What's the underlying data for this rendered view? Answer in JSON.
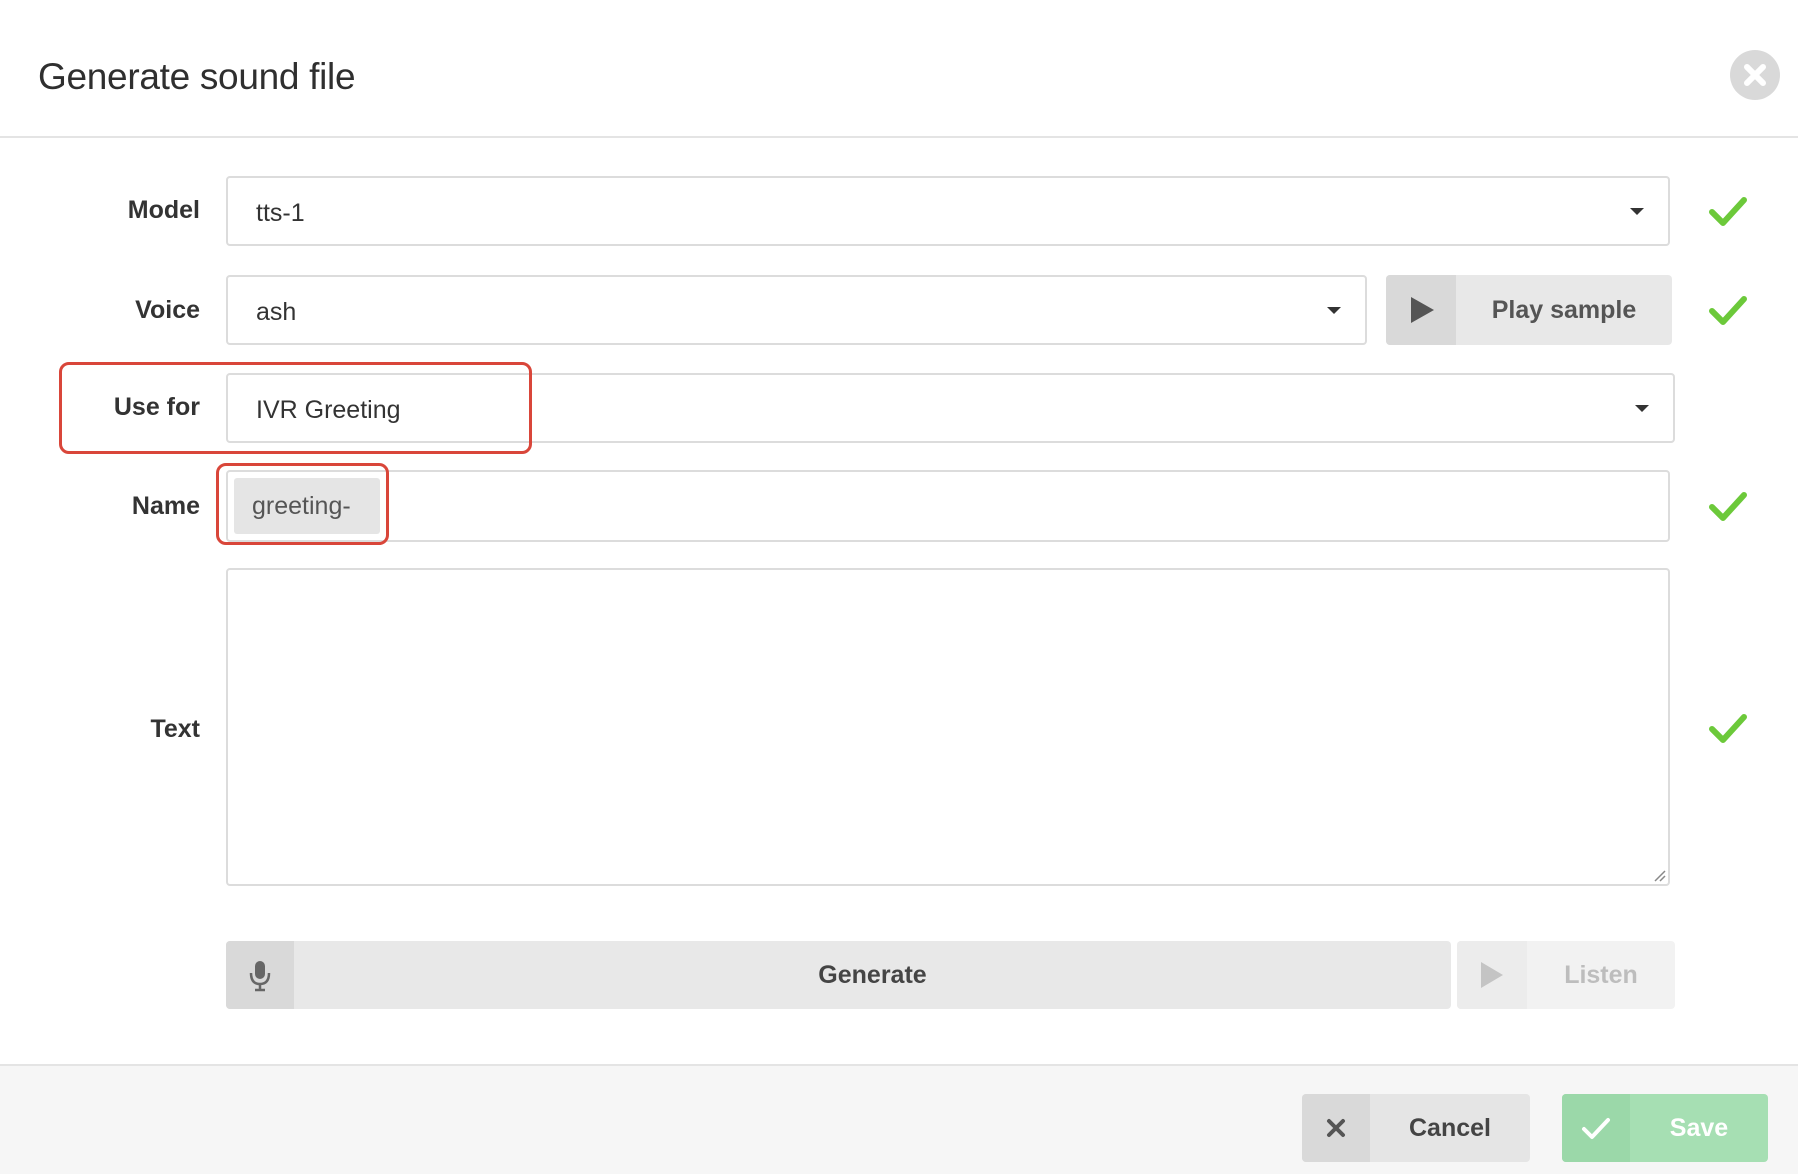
{
  "dialog": {
    "title": "Generate sound file"
  },
  "form": {
    "model": {
      "label": "Model",
      "value": "tts-1"
    },
    "voice": {
      "label": "Voice",
      "value": "ash",
      "play_sample_label": "Play sample"
    },
    "use_for": {
      "label": "Use for",
      "value": "IVR Greeting"
    },
    "name": {
      "label": "Name",
      "prefix": "greeting-",
      "value": ""
    },
    "text": {
      "label": "Text",
      "value": ""
    },
    "generate_label": "Generate",
    "listen_label": "Listen"
  },
  "footer": {
    "cancel_label": "Cancel",
    "save_label": "Save"
  },
  "colors": {
    "check": "#6cc93a",
    "highlight": "#d9463a",
    "save_bg": "#a6dfb3",
    "button_bg": "#e8e8e8"
  },
  "icons": {
    "close": "close-circle-icon",
    "dropdown": "caret-down-icon",
    "valid": "checkmark-icon",
    "play": "play-icon",
    "mic": "microphone-icon",
    "cancel": "x-icon",
    "save": "checkmark-icon"
  }
}
